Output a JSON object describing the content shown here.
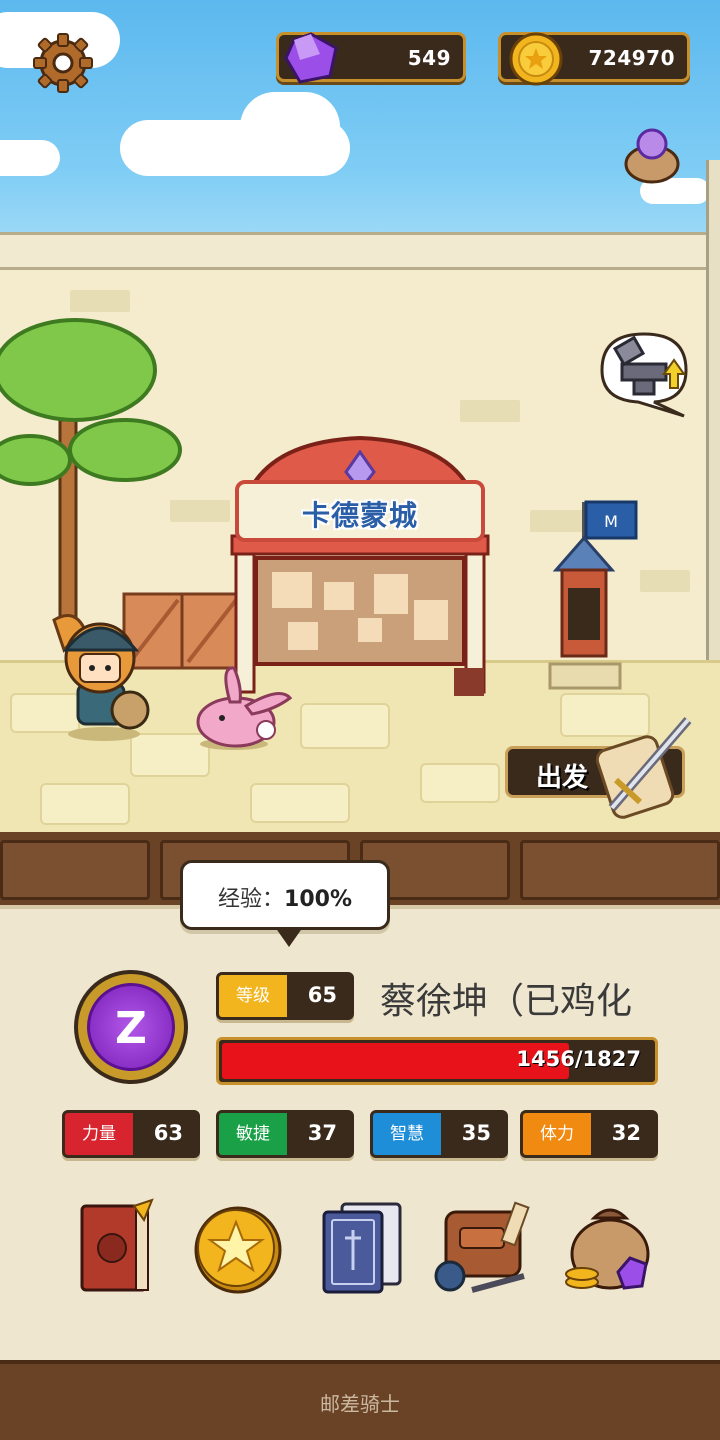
{
  "hud": {
    "gems": "549",
    "gold": "724970"
  },
  "town": {
    "sign": "卡德蒙城",
    "depart_label": "出发"
  },
  "hero": {
    "exp_label": "经验：",
    "exp_value": "100%",
    "avatar_letter": "Z",
    "level_label": "等级",
    "level": "65",
    "name": "蔡徐坤（已鸡化",
    "hp_text": "1456/1827",
    "hp_current": 1456,
    "hp_max": 1827,
    "stats": [
      {
        "label": "力量",
        "value": "63",
        "color": "#d8242e"
      },
      {
        "label": "敏捷",
        "value": "37",
        "color": "#1aa046"
      },
      {
        "label": "智慧",
        "value": "35",
        "color": "#1f8ed8"
      },
      {
        "label": "体力",
        "value": "32",
        "color": "#f08a10"
      }
    ]
  },
  "menu_icons": [
    "journal-book-icon",
    "gold-star-coin-icon",
    "card-deck-icon",
    "backpack-potion-icon",
    "treasure-bag-icon"
  ],
  "footer": {
    "title": "邮差骑士"
  },
  "colors": {
    "level_tag": "#f2b51e",
    "hp": "#e8121a",
    "gem": "#9b4ee8",
    "gold": "#f2b51e"
  }
}
